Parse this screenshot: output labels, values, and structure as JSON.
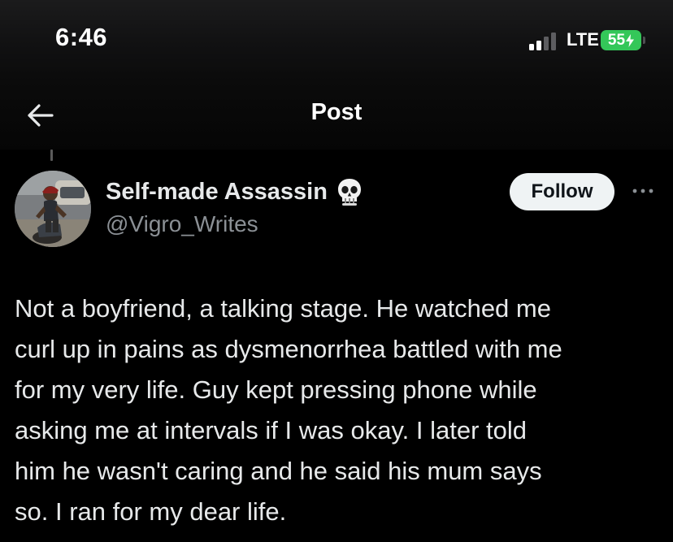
{
  "status_bar": {
    "time": "6:46",
    "network": "LTE",
    "battery_level": "55",
    "battery_color": "#34c759",
    "icons": [
      "cellular-signal-icon",
      "battery-charging-icon"
    ]
  },
  "nav": {
    "title": "Post",
    "back_icon": "arrow-left-icon"
  },
  "post": {
    "author": {
      "display_name": "Self-made Assassin",
      "badge_emoji": "skull-icon",
      "handle": "@Vigro_Writes"
    },
    "follow_label": "Follow",
    "more_icon": "more-horizontal-icon",
    "lines": [
      "Not a boyfriend, a talking stage. He watched me",
      "curl up in pains as dysmenorrhea battled with me",
      "for my very life. Guy kept pressing phone while",
      "asking me at intervals if I was okay. I later told",
      "him he wasn't caring and he said his mum says",
      "so. I ran for my dear life."
    ]
  }
}
